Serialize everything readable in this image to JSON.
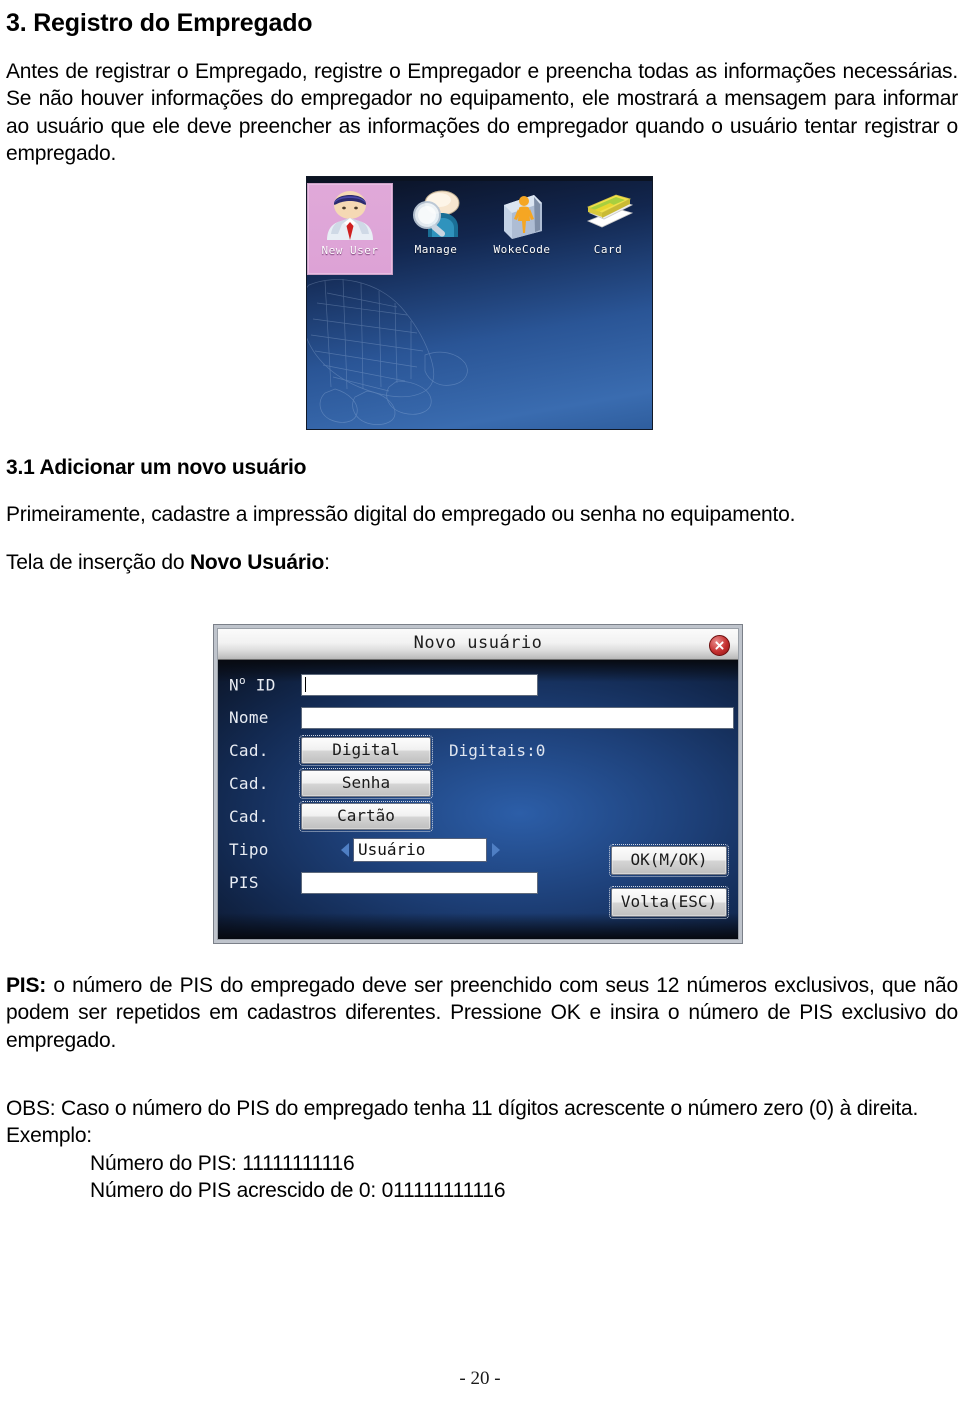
{
  "document": {
    "heading": "3. Registro do Empregado",
    "intro_paragraph": "Antes de registrar o Empregado, registre o Empregador e preencha todas as informações necessárias. Se não houver informações do empregador no equipamento, ele mostrará a mensagem para informar ao usuário que ele deve preencher as informações do empregador quando o usuário tentar registrar o empregado.",
    "subheading": "3.1 Adicionar um novo usuário",
    "paragraph_primeiramente": "Primeiramente, cadastre a impressão digital do empregado ou senha no equipamento.",
    "tela_prefix": "Tela de inserção do ",
    "tela_bold": "Novo Usuário",
    "tela_suffix": ":",
    "pis_label": "PIS:",
    "pis_paragraph": " o número de PIS do empregado deve ser preenchido com seus 12 números exclusivos, que não podem ser repetidos em cadastros diferentes. Pressione OK e insira o número de PIS exclusivo do empregado.",
    "obs_paragraph": "OBS: Caso o número do PIS do empregado tenha 11 dígitos acrescente o número zero (0) à direita.",
    "exemplo_label": "Exemplo:",
    "exemplo_line1": "Número do PIS: 11111111116",
    "exemplo_line2": "Número do PIS acrescido de 0: 011111111116",
    "page_number": "- 20 -"
  },
  "figure_device": {
    "caption_alt": "Tela inicial do equipamento",
    "menu_items": [
      {
        "label": "New User",
        "icon": "user-avatar-icon",
        "selected": true
      },
      {
        "label": "Manage",
        "icon": "magnifier-speech-icon",
        "selected": false
      },
      {
        "label": "WokeCode",
        "icon": "person-book-icon",
        "selected": false
      },
      {
        "label": "Card",
        "icon": "id-cards-icon",
        "selected": false
      }
    ],
    "colors": {
      "background_top": "#0a1020",
      "background_bottom": "#2f5e9e",
      "selected_highlight": "#dfa8d8",
      "label_text": "#ffffff"
    }
  },
  "figure_dialog": {
    "title": "Novo usuário",
    "close_icon": "close-icon",
    "fields": {
      "id_label": "N° ID",
      "id_value": "",
      "nome_label": "Nome",
      "nome_value": "",
      "cad_digital_label": "Cad.",
      "cad_digital_button": "Digital",
      "digitais_count": "Digitais:0",
      "cad_senha_label": "Cad.",
      "cad_senha_button": "Senha",
      "cad_cartao_label": "Cad.",
      "cad_cartao_button": "Cartão",
      "tipo_label": "Tipo",
      "tipo_value": "Usuário",
      "pis_label": "PIS",
      "pis_value": ""
    },
    "buttons": {
      "ok": "OK(M/OK)",
      "back": "Volta(ESC)"
    },
    "colors": {
      "body_blue": "#2c5ea8",
      "titlebar": "#f2f2f2",
      "close_red": "#c53030"
    }
  }
}
